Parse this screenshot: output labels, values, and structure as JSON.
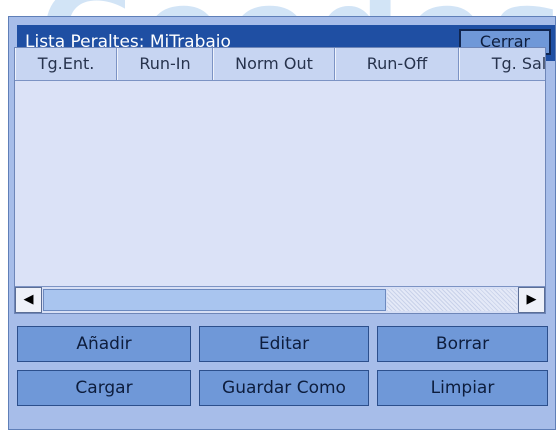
{
  "watermark": "Geodes",
  "window": {
    "title": "Lista Peraltes: MiTrabajo",
    "close_label": "Cerrar"
  },
  "table": {
    "columns": [
      "Tg.Ent.",
      "Run-In",
      "Norm Out",
      "Run-Off",
      "Tg. Sal"
    ],
    "rows": []
  },
  "scrollbar": {
    "left_arrow": "◀",
    "right_arrow": "▶"
  },
  "buttons": {
    "add": "Añadir",
    "edit": "Editar",
    "delete": "Borrar",
    "load": "Cargar",
    "save_as": "Guardar Como",
    "clear": "Limpiar"
  }
}
